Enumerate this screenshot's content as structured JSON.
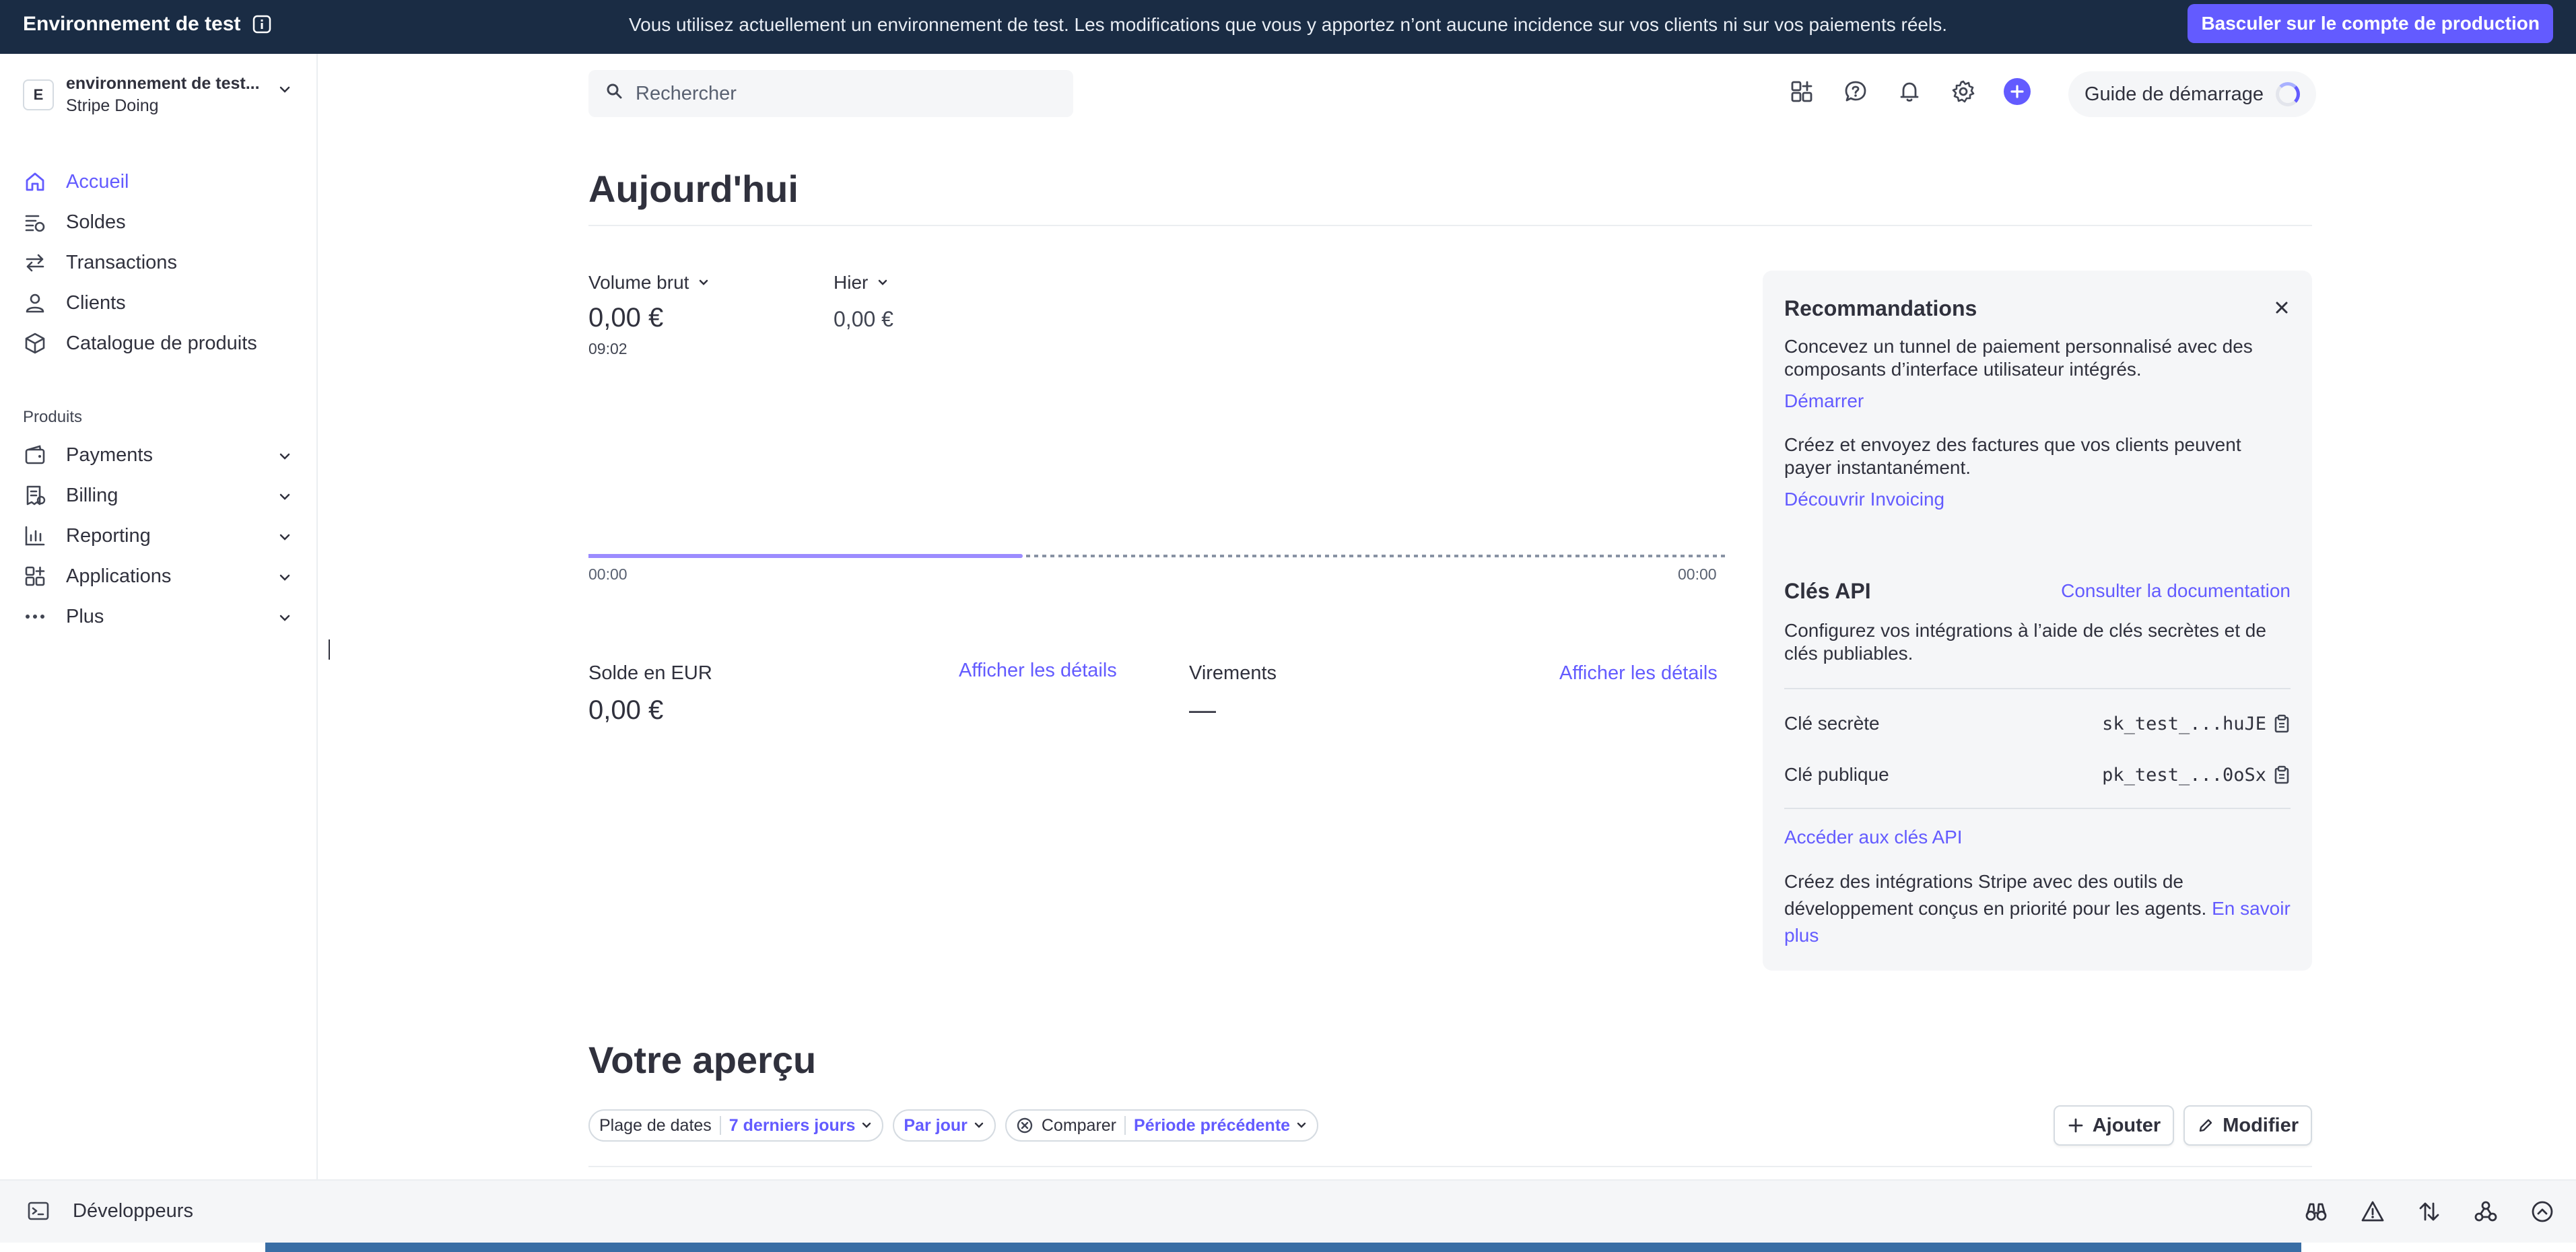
{
  "banner": {
    "title": "Environnement de test",
    "message": "Vous utilisez actuellement un environnement de test. Les modifications que vous y apportez n’ont aucune incidence sur vos clients ni sur vos paiements réels.",
    "button": "Basculer sur le compte de production"
  },
  "account": {
    "initial": "E",
    "name": "environnement de test...",
    "sub": "Stripe Doing"
  },
  "nav": {
    "primary": [
      {
        "label": "Accueil",
        "icon": "home-icon",
        "active": true
      },
      {
        "label": "Soldes",
        "icon": "balances-icon"
      },
      {
        "label": "Transactions",
        "icon": "arrows-icon"
      },
      {
        "label": "Clients",
        "icon": "person-icon"
      },
      {
        "label": "Catalogue de produits",
        "icon": "box-icon"
      }
    ],
    "section_label": "Produits",
    "products": [
      {
        "label": "Payments",
        "icon": "wallet-icon"
      },
      {
        "label": "Billing",
        "icon": "invoice-icon"
      },
      {
        "label": "Reporting",
        "icon": "bar-chart-icon"
      },
      {
        "label": "Applications",
        "icon": "apps-icon"
      },
      {
        "label": "Plus",
        "icon": "more-icon"
      }
    ]
  },
  "bottom": {
    "developers": "Développeurs"
  },
  "header": {
    "search_placeholder": "Rechercher",
    "guide": "Guide de démarrage"
  },
  "today": {
    "title": "Aujourd'hui",
    "gross_label": "Volume brut",
    "gross_value": "0,00 €",
    "gross_time": "09:02",
    "yesterday_label": "Hier",
    "yesterday_value": "0,00 €",
    "chart_start": "00:00",
    "chart_end": "00:00",
    "balance_label": "Solde en EUR",
    "balance_value": "0,00 €",
    "balance_link": "Afficher les détails",
    "payouts_label": "Virements",
    "payouts_value": "—",
    "payouts_link": "Afficher les détails"
  },
  "panel": {
    "title": "Recommandations",
    "rec1_text": "Concevez un tunnel de paiement personnalisé avec des composants d’interface utilisateur intégrés.",
    "rec1_link": "Démarrer",
    "rec2_text": "Créez et envoyez des factures que vos clients peuvent payer instantanément.",
    "rec2_link": "Découvrir Invoicing",
    "api_title": "Clés API",
    "api_doc_link": "Consulter la documentation",
    "api_text": "Configurez vos intégrations à l’aide de clés secrètes et de clés publiables.",
    "secret_label": "Clé secrète",
    "secret_value": "sk_test_...huJE",
    "public_label": "Clé publique",
    "public_value": "pk_test_...0oSx",
    "api_keys_link": "Accéder aux clés API",
    "agents_text": "Créez des intégrations Stripe avec des outils de développement conçus en priorité pour les agents.",
    "agents_link": "En savoir plus"
  },
  "overview": {
    "title": "Votre aperçu",
    "date_range_label": "Plage de dates",
    "date_range_value": "7 derniers jours",
    "interval_value": "Par jour",
    "compare_label": "Comparer",
    "compare_value": "Période précédente",
    "add_button": "Ajouter",
    "edit_button": "Modifier"
  },
  "colors": {
    "accent": "#635bff",
    "banner": "#1a2c44",
    "panel": "#f5f6f8"
  }
}
